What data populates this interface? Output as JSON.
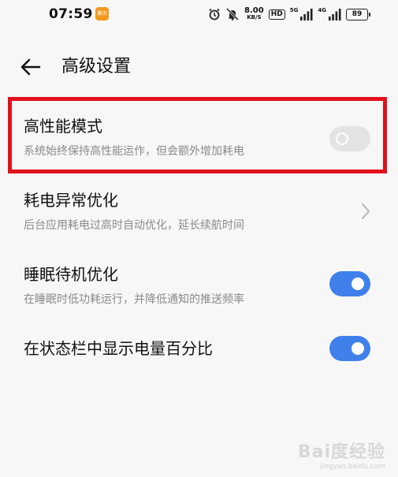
{
  "status_bar": {
    "time": "07:59",
    "app_badge": "腾讯",
    "net_speed_value": "8.00",
    "net_speed_unit": "KB/S",
    "hd_label": "HD",
    "sim1_network": "5G",
    "sim2_network": "4G",
    "battery": "89"
  },
  "header": {
    "title": "高级设置"
  },
  "settings": [
    {
      "title": "高性能模式",
      "subtitle": "系统始终保持高性能运作，但会额外增加耗电",
      "control": "toggle",
      "state": "off"
    },
    {
      "title": "耗电异常优化",
      "subtitle": "后台应用耗电过高时自动优化，延长续航时间",
      "control": "chevron"
    },
    {
      "title": "睡眠待机优化",
      "subtitle": "在睡眠时低功耗运行，并降低通知的推送频率",
      "control": "toggle",
      "state": "on"
    },
    {
      "title": "在状态栏中显示电量百分比",
      "subtitle": "",
      "control": "toggle",
      "state": "on"
    }
  ],
  "watermark": {
    "text": "Bai度经验",
    "sub": "jingyan.baidu.com"
  },
  "colors": {
    "toggle_on": "#3f80ea",
    "toggle_off": "#e3e3e3",
    "highlight_border": "#e3101e",
    "background": "#f7f7f7"
  }
}
